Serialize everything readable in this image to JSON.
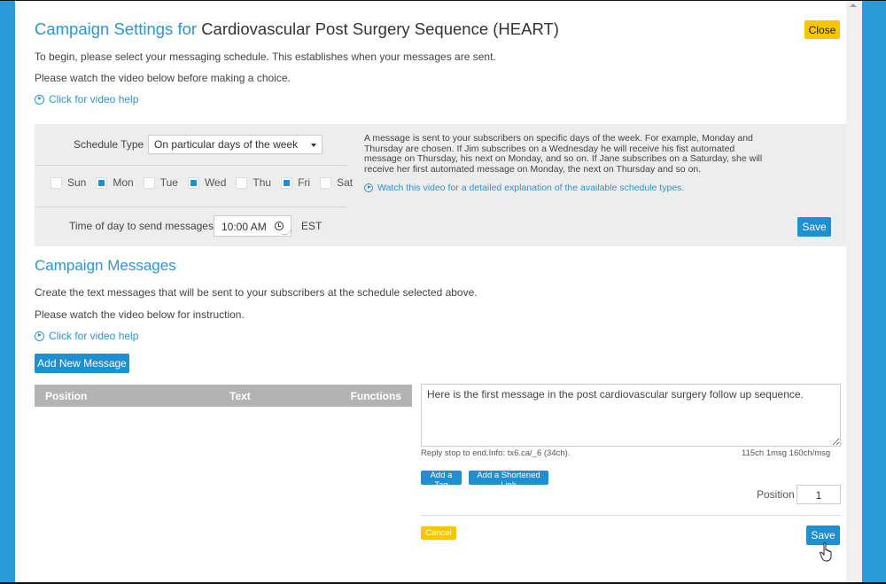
{
  "header": {
    "title_prefix": "Campaign Settings for",
    "title_name": "Cardiovascular Post Surgery Sequence (HEART)",
    "close_label": "Close"
  },
  "intro": {
    "line1": "To begin, please select your messaging schedule. This establishes when your messages are sent.",
    "line2": "Please watch the video below before making a choice.",
    "video_link": "Click for video help"
  },
  "schedule": {
    "type_label": "Schedule Type",
    "type_value": "On particular days of the week",
    "days": [
      {
        "label": "Sun",
        "checked": false
      },
      {
        "label": "Mon",
        "checked": true
      },
      {
        "label": "Tue",
        "checked": false
      },
      {
        "label": "Wed",
        "checked": true
      },
      {
        "label": "Thu",
        "checked": false
      },
      {
        "label": "Fri",
        "checked": true
      },
      {
        "label": "Sat",
        "checked": false
      }
    ],
    "time_label": "Time of day to send messages",
    "time_value": "10:00 AM",
    "timezone": "EST",
    "description": "A message is sent to your subscribers on specific days of the week. For example, Monday and Thursday are chosen. If Jim subscribes on a Wednesday he will receive his fist automated message on Thursday, his next on Monday, and so on. If Jane subscribes on a Saturday, she will receive her first automated message on Monday, the next on Thursday and so on.",
    "video_link": "Watch this video for a detailed explanation of the available schedule types.",
    "save_label": "Save"
  },
  "messages": {
    "title": "Campaign Messages",
    "line1": "Create the text messages that will be sent to your subscribers at the schedule selected above.",
    "line2": "Please watch the video below for instruction.",
    "video_link": "Click for video help",
    "add_label": "Add New Message",
    "table_headers": [
      "Position",
      "Text",
      "Functions"
    ],
    "editor": {
      "text": "Here is the first message in the post cardiovascular surgery follow up sequence.",
      "footer_info": "Reply stop to end.Info: tx6.ca/_6 (34ch).",
      "counts": "115ch 1msg 160ch/msg",
      "add_tag_label": "Add a Tag",
      "add_link_label": "Add a Shortened Link",
      "position_label": "Position",
      "position_value": "1",
      "cancel_label": "Cancel",
      "save_label": "Save"
    }
  },
  "colors": {
    "accent": "#2e95cf",
    "button_blue": "#1e8fd0",
    "button_yellow": "#f7c600",
    "frame_blue": "#2b9bd8"
  }
}
